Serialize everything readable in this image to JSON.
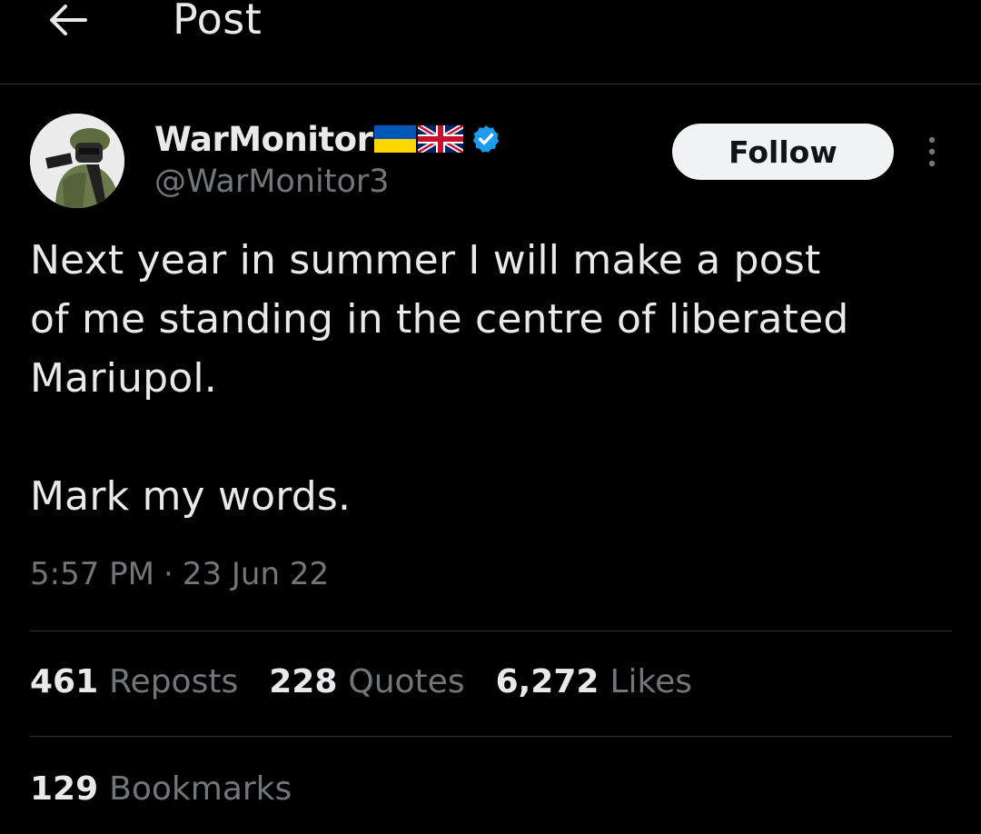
{
  "header": {
    "title": "Post",
    "back_icon": "arrow-left-icon"
  },
  "author": {
    "display_name": "WarMonitor",
    "flags": [
      "ukraine-flag",
      "uk-flag"
    ],
    "verified_icon": "verified-badge-icon",
    "handle": "@WarMonitor3",
    "follow_label": "Follow",
    "more_icon": "more-vertical-icon"
  },
  "post": {
    "text": "Next year in summer I will make a post\nof me standing in the centre of liberated\nMariupol.\n\nMark my words.",
    "time": "5:57 PM",
    "separator": "·",
    "date": "23 Jun 22"
  },
  "stats": {
    "reposts_count": "461",
    "reposts_label": "Reposts",
    "quotes_count": "228",
    "quotes_label": "Quotes",
    "likes_count": "6,272",
    "likes_label": "Likes",
    "bookmarks_count": "129",
    "bookmarks_label": "Bookmarks"
  },
  "colors": {
    "background": "#000000",
    "primary_text": "#e7e9ea",
    "secondary_text": "#71767b",
    "divider": "#2f3336",
    "verified": "#1d9bf0",
    "follow_bg": "#eff3f4"
  }
}
